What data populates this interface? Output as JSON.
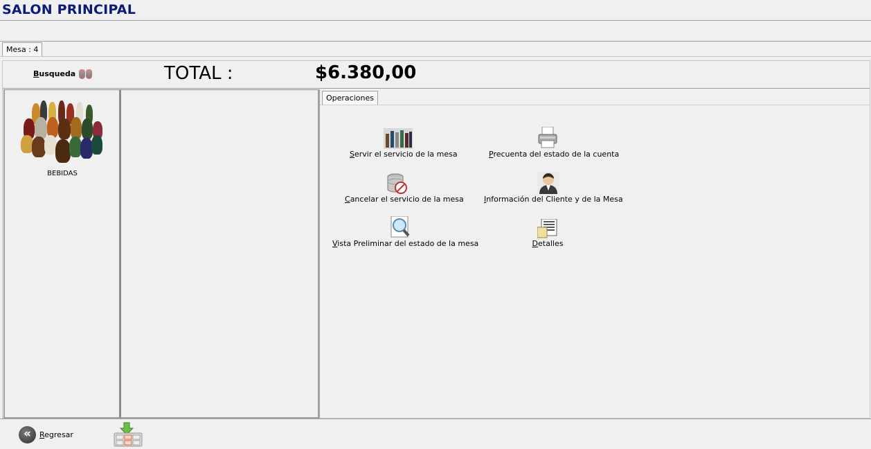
{
  "window": {
    "title": "SALON PRINCIPAL"
  },
  "tabs": {
    "mesa": "Mesa : 4"
  },
  "header": {
    "search_label": "Busqueda",
    "total_label": "TOTAL :",
    "total_value": "$6.380,00"
  },
  "categories": [
    {
      "label": "BEBIDAS",
      "icon": "bottles-icon"
    }
  ],
  "operations": {
    "tab_label": "Operaciones",
    "items": [
      {
        "label": "Servir el servicio de la mesa",
        "icon": "serve-bottles-icon"
      },
      {
        "label": "Precuenta del estado de la cuenta",
        "icon": "printer-icon"
      },
      {
        "label": "Cancelar el servicio de la mesa",
        "icon": "cancel-database-icon"
      },
      {
        "label": "Información del Cliente y de la Mesa",
        "icon": "customer-icon"
      },
      {
        "label": "Vista Preliminar del estado de la mesa",
        "icon": "preview-magnifier-icon"
      },
      {
        "label": "Detalles",
        "icon": "details-document-icon"
      }
    ]
  },
  "footer": {
    "back_label": "Regresar",
    "keyboard_icon": "keyboard-download-icon"
  },
  "colors": {
    "title": "#0b1b7a",
    "background": "#f0f0f0",
    "border": "#a0a0a0"
  }
}
